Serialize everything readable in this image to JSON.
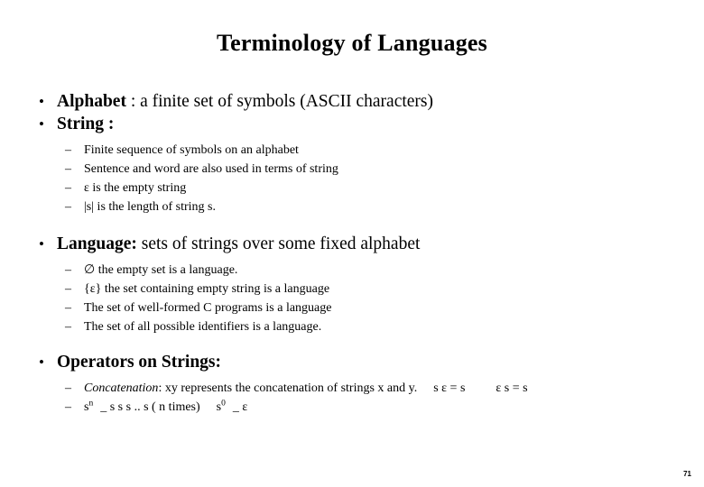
{
  "slide": {
    "title": "Terminology of Languages",
    "page_number": "71",
    "background_color": "#ffffff",
    "text_color": "#000000"
  },
  "bullet_markers": {
    "level1": "•",
    "level2": "–"
  },
  "groups": [
    {
      "lead": "Alphabet",
      "rest": " : a finite set of symbols  (ASCII characters)",
      "sub_items": []
    },
    {
      "lead": "String :",
      "rest": "",
      "sub_items": [
        "Finite sequence of symbols on an alphabet",
        "Sentence and word are also used in terms of string",
        "ε  is the empty string",
        "|s| is the length of string s."
      ]
    },
    {
      "lead": "Language:",
      "rest": " sets of strings over some fixed alphabet",
      "sub_items": [
        "∅ the empty set is a language.",
        "{ε} the set containing empty string is a language",
        "The set of well-formed C programs is a language",
        "The set of all possible identifiers is a language."
      ]
    },
    {
      "lead": "Operators on Strings:",
      "rest": "",
      "sub_items": []
    }
  ],
  "operators": {
    "concatenation": {
      "term": "Concatenation",
      "description": ": xy represents the concatenation of strings x and y.",
      "identity_right": "s ε = s",
      "identity_left": "ε s = s"
    },
    "power": {
      "base": "s",
      "exponent_n": "n",
      "expansion": "_ s s s .. s ( n times)",
      "base_zero": "s",
      "exponent_zero": "0",
      "zero_value": "_ ε"
    }
  }
}
